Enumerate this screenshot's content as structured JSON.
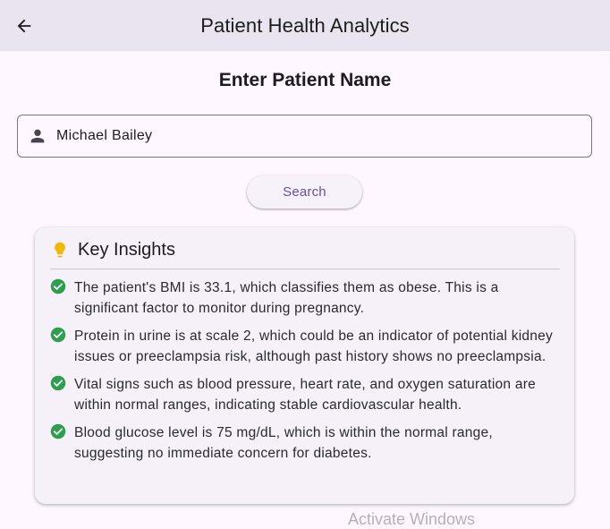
{
  "appbar": {
    "title": "Patient Health Analytics",
    "back_icon": "arrow-back-icon"
  },
  "form": {
    "heading": "Enter Patient Name",
    "name_value": "Michael Bailey",
    "name_icon": "person-icon",
    "search_label": "Search"
  },
  "insights": {
    "title": "Key Insights",
    "title_icon": "lightbulb-icon",
    "items": [
      "The patient's BMI is 33.1, which classifies them as obese. This is a significant factor to monitor during pregnancy.",
      "Protein in urine is at scale 2, which could be an indicator of potential kidney issues or preeclampsia risk, although past history shows no preeclampsia.",
      "Vital signs such as blood pressure, heart rate, and oxygen saturation are within normal ranges, indicating stable cardiovascular health.",
      "Blood glucose level is 75 mg/dL, which is within the normal range, suggesting no immediate concern for diabetes."
    ]
  },
  "watermark": "Activate Windows",
  "colors": {
    "appbar_bg": "#e9e4f0",
    "background": "#fef7ff",
    "primary": "#6750a4",
    "check": "#2e9e4f",
    "bulb": "#f5b800"
  }
}
